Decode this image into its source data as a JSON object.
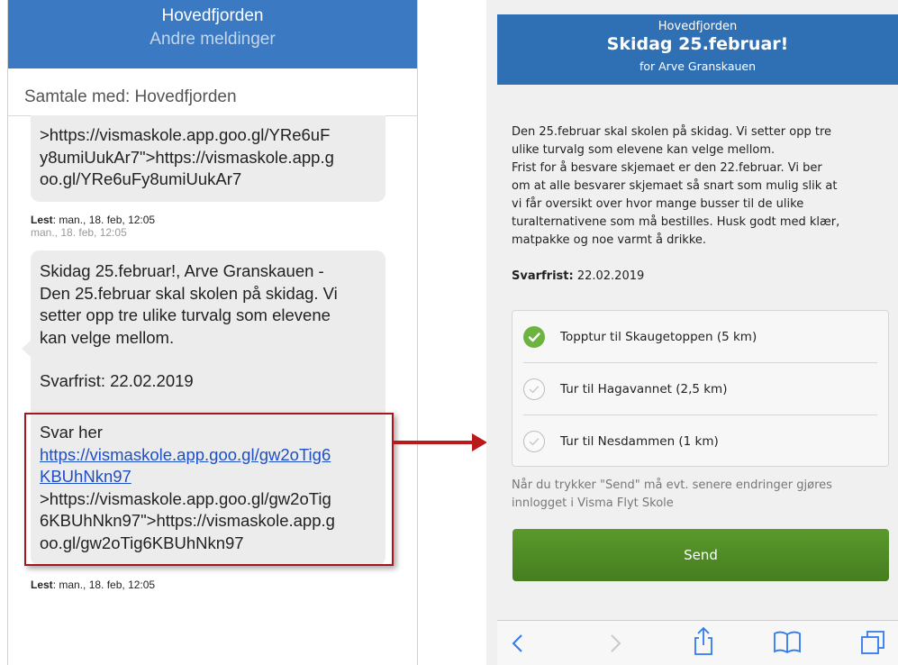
{
  "left": {
    "header_title": "Hovedfjorden",
    "header_subtitle": "Andre meldinger",
    "conversation_label": "Samtale med: Hovedfjorden",
    "bubble1_lines": [
      ">https://vismaskole.app.goo.gl/YRe6uF",
      "y8umiUukAr7\">https://vismaskole.app.g",
      "oo.gl/YRe6uFy8umiUukAr7"
    ],
    "read1_label": "Lest",
    "read1_time": ": man., 18. feb, 12:05",
    "date_stamp": "man., 18. feb, 12:05",
    "bubble2_lines": [
      "Skidag 25.februar!, Arve Granskauen -",
      "Den 25.februar skal skolen på skidag. Vi",
      "setter opp tre ulike turvalg som elevene",
      "kan velge mellom."
    ],
    "bubble2_deadline": "Svarfrist: 22.02.2019",
    "answer_label": "Svar her",
    "link_lines": [
      "https://vismaskole.app.goo.gl/gw2oTig6",
      "KBUhNkn97"
    ],
    "bubble2_tail_lines": [
      ">https://vismaskole.app.goo.gl/gw2oTig",
      "6KBUhNkn97\">https://vismaskole.app.g",
      "oo.gl/gw2oTig6KBUhNkn97"
    ],
    "read2_label": "Lest",
    "read2_time": ": man., 18. feb, 12:05"
  },
  "right": {
    "school": "Hovedfjorden",
    "title": "Skidag 25.februar!",
    "for_line": "for Arve Granskauen",
    "body_lines": [
      "Den 25.februar skal skolen på skidag. Vi setter opp tre",
      "ulike turvalg som elevene kan velge mellom.",
      "Frist for å besvare skjemaet er den 22.februar. Vi ber",
      "om at alle besvarer skjemaet så snart som mulig slik at",
      "vi får oversikt over hvor mange busser til de ulike",
      "turalternativene som må bestilles. Husk godt med klær,",
      "matpakke og noe varmt å drikke."
    ],
    "deadline_label": "Svarfrist:",
    "deadline_value": " 22.02.2019",
    "options": [
      {
        "label": "Topptur til Skaugetoppen (5 km)",
        "selected": true
      },
      {
        "label": "Tur til Hagavannet (2,5 km)",
        "selected": false
      },
      {
        "label": "Tur til Nesdammen (1 km)",
        "selected": false
      }
    ],
    "note_lines": [
      "Når du trykker \"Send\" må evt. senere endringer gjøres",
      "innlogget i Visma Flyt Skole"
    ],
    "send_label": "Send",
    "toolbar_icons": [
      "back-icon",
      "forward-icon",
      "share-icon",
      "bookmarks-icon",
      "tabs-icon"
    ]
  },
  "colors": {
    "left_header": "#3b7ac2",
    "right_header": "#2f70b4",
    "send_button": "#4f8a26",
    "checked": "#6cb33f",
    "highlight": "#a5161d",
    "link": "#1f4fc4"
  }
}
